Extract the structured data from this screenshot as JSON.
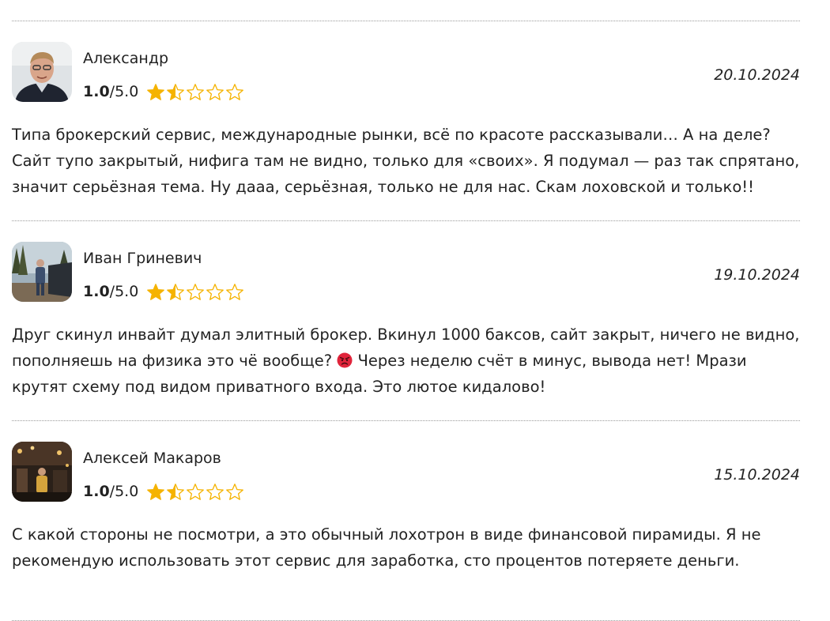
{
  "reviews": [
    {
      "author": "Александр",
      "score": "1.0",
      "score_max": "/5.0",
      "rating_value": 1.0,
      "rating_max": 5,
      "date": "20.10.2024",
      "text": "Типа брокерский сервис, международные рынки, всё по красоте рассказывали… А на деле? Сайт тупо закрытый, нифига там не видно, только для «своих». Я подумал — раз так спрятано, значит серьёзная тема. Ну дааа, серьёзная, только не для нас. Скам лоховской и только!!"
    },
    {
      "author": "Иван Гриневич",
      "score": "1.0",
      "score_max": "/5.0",
      "rating_value": 1.0,
      "rating_max": 5,
      "date": "19.10.2024",
      "text_before_emoji": "Друг скинул инвайт думал элитный брокер. Вкинул 1000 баксов, сайт закрыт, ничего не видно, пополняешь на физика это чё вообще? ",
      "emoji": "angry-face",
      "text_after_emoji": " Через неделю счёт в минус, вывода нет! Мрази крутят схему под видом приватного входа. Это лютое кидалово!"
    },
    {
      "author": "Алексей Макаров",
      "score": "1.0",
      "score_max": "/5.0",
      "rating_value": 1.0,
      "rating_max": 5,
      "date": "15.10.2024",
      "text": "С какой стороны не посмотри, а это обычный лохотрон в виде финансовой пирамиды. Я не рекомендую использовать этот сервис для заработка, сто процентов потеряете деньги."
    }
  ],
  "colors": {
    "star": "#F5B301",
    "divider": "#9a9a9a",
    "text": "#222222"
  }
}
